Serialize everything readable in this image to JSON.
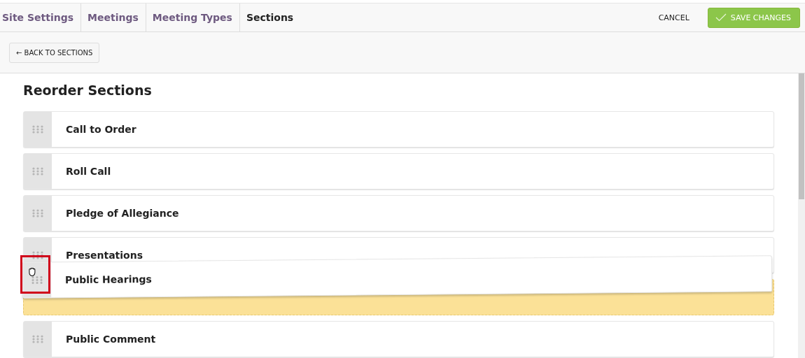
{
  "tabs": [
    {
      "label": "Site Settings",
      "selected": false
    },
    {
      "label": "Meetings",
      "selected": false
    },
    {
      "label": "Meeting Types",
      "selected": false
    },
    {
      "label": "Sections",
      "selected": true
    }
  ],
  "actions": {
    "cancel": "CANCEL",
    "save": "SAVE CHANGES"
  },
  "back_button": "← BACK TO SECTIONS",
  "heading": "Reorder Sections",
  "sections": [
    {
      "name": "Call to Order",
      "dragging": false
    },
    {
      "name": "Roll Call",
      "dragging": false
    },
    {
      "name": "Pledge of Allegiance",
      "dragging": false
    },
    {
      "name": "Presentations",
      "dragging": false
    },
    {
      "name": "Public Hearings",
      "dragging": true
    },
    {
      "name": "Public Comment",
      "dragging": false
    }
  ]
}
